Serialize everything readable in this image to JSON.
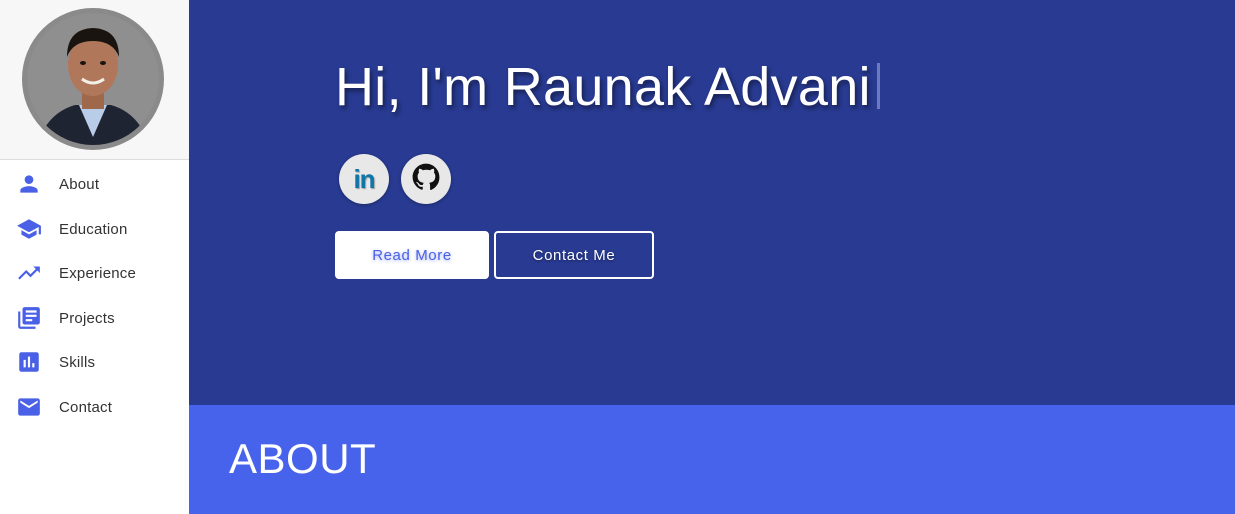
{
  "sidebar": {
    "avatar_alt": "Profile photo",
    "items": [
      {
        "label": "About",
        "icon": "person-icon"
      },
      {
        "label": "Education",
        "icon": "graduation-cap-icon"
      },
      {
        "label": "Experience",
        "icon": "trending-up-icon"
      },
      {
        "label": "Projects",
        "icon": "library-books-icon"
      },
      {
        "label": "Skills",
        "icon": "bar-chart-icon"
      },
      {
        "label": "Contact",
        "icon": "mail-icon"
      }
    ]
  },
  "hero": {
    "title": "Hi, I'm Raunak Advani",
    "social": {
      "linkedin_text": "in",
      "linkedin_icon": "linkedin-icon",
      "github_icon": "github-icon"
    },
    "buttons": {
      "read_more": "Read More",
      "contact_me": "Contact Me"
    }
  },
  "about": {
    "title": "ABOUT"
  },
  "colors": {
    "hero_bg": "#283a91",
    "about_bg": "#4763ec",
    "accent": "#4a60e6",
    "linkedin": "#0e76a8"
  }
}
